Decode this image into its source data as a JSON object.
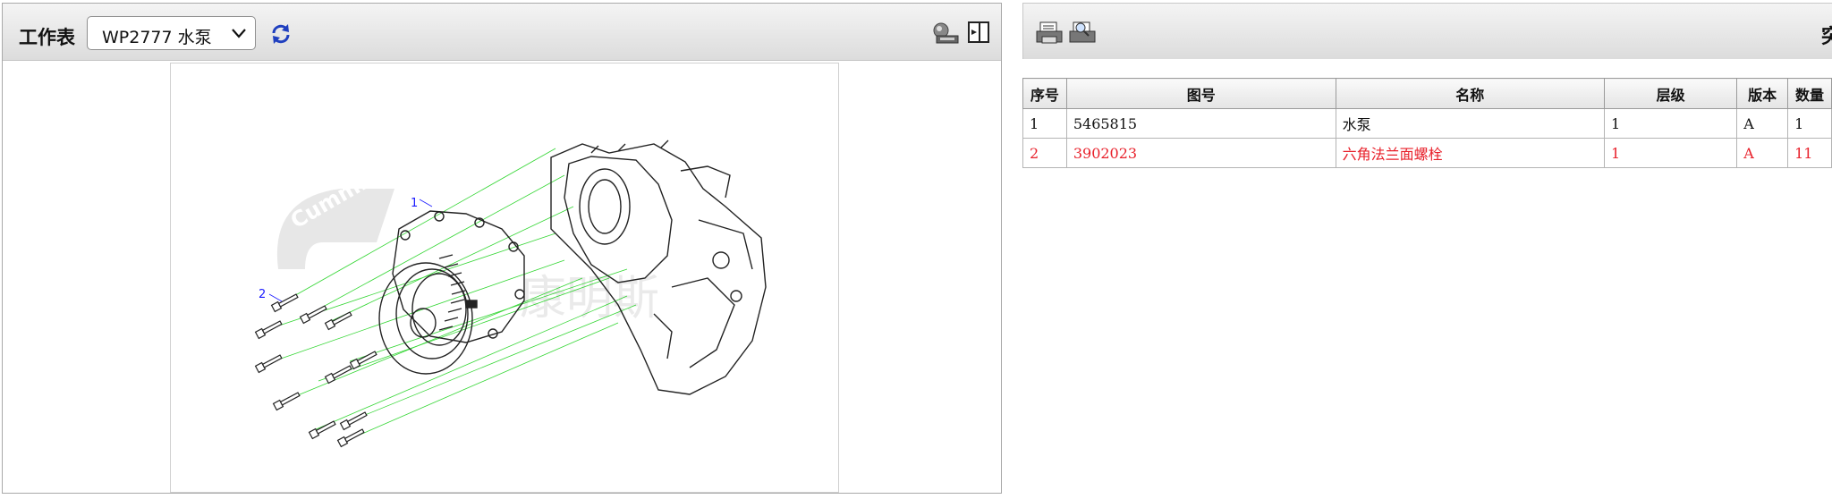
{
  "left_panel": {
    "toolbar": {
      "worksheet_label": "工作表",
      "worksheet_select": {
        "value": "WP2777 水泵"
      }
    },
    "drawing": {
      "callouts": [
        "1",
        "2"
      ],
      "watermark_text": "康明斯",
      "watermark_logo": "Cummins"
    }
  },
  "right_panel": {
    "toolbar": {
      "cut_text": "突"
    },
    "parts_table": {
      "columns": [
        "序号",
        "图号",
        "名称",
        "层级",
        "版本",
        "数量"
      ],
      "rows": [
        {
          "seq": "1",
          "part_no": "5465815",
          "name": "水泵",
          "level": "1",
          "version": "A",
          "qty": "1",
          "highlighted": false
        },
        {
          "seq": "2",
          "part_no": "3902023",
          "name": "六角法兰面螺栓",
          "level": "1",
          "version": "A",
          "qty": "11",
          "highlighted": true
        }
      ]
    }
  },
  "colors": {
    "highlight_row": "#e8202a",
    "callout": "#1a1aff",
    "leader_lines": "#00cc00",
    "refresh_icon": "#1f3fbf"
  },
  "icons": [
    "chevron-down-icon",
    "refresh-icon",
    "view-options-icon",
    "export-panel-icon",
    "print-icon",
    "print-preview-icon"
  ]
}
